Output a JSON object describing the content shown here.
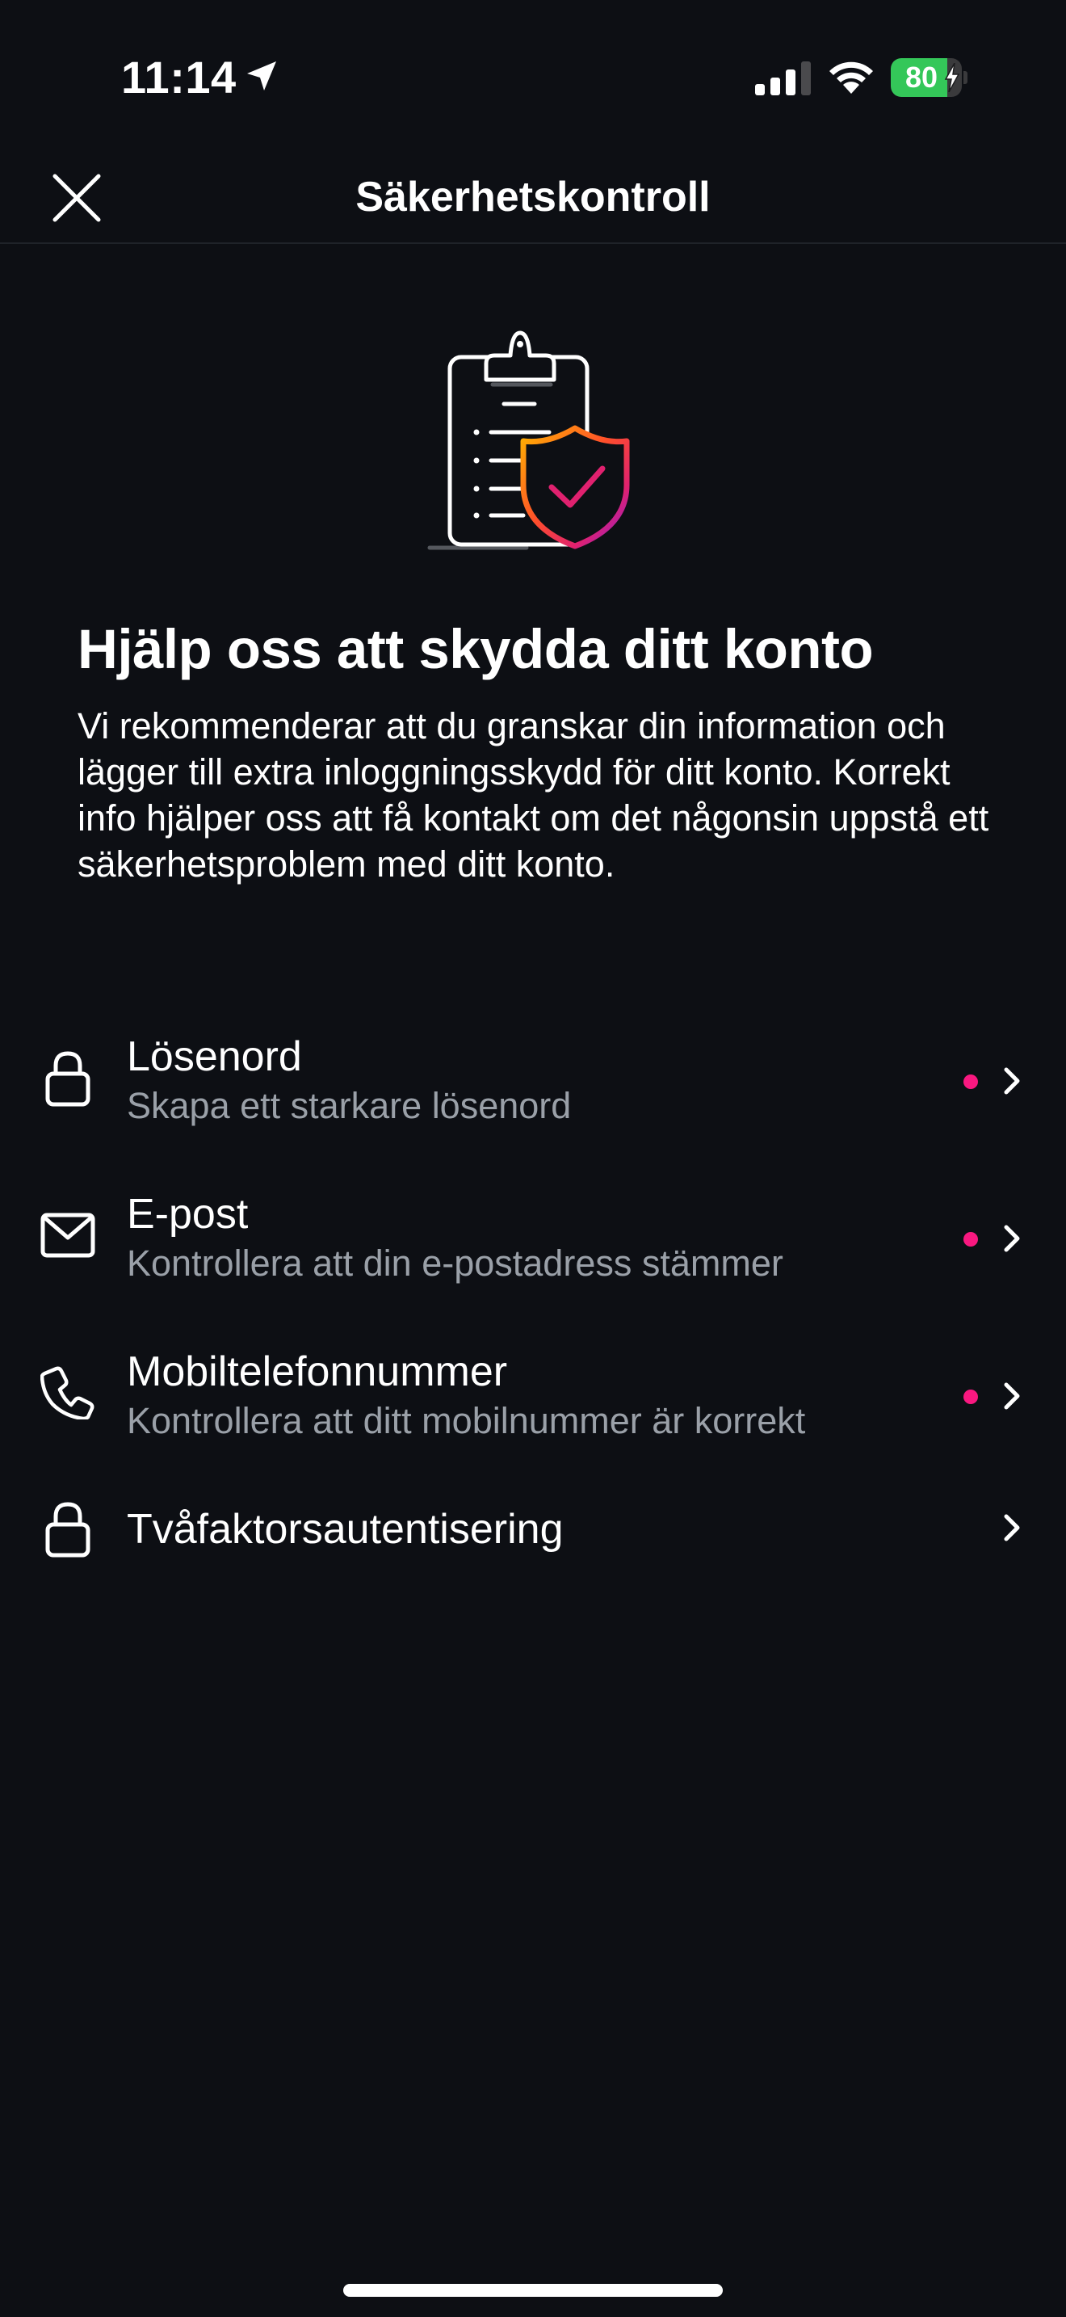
{
  "status_bar": {
    "time": "11:14",
    "battery_level": "80",
    "battery_percent": 0.8,
    "icons": [
      "location-arrow-icon",
      "signal-icon",
      "wifi-icon",
      "battery-charging-icon"
    ]
  },
  "header": {
    "title": "Säkerhetskontroll",
    "close_icon": "close-icon"
  },
  "main": {
    "illustration_icon": "clipboard-shield-check-icon",
    "headline": "Hjälp oss att skydda ditt konto",
    "intro": "Vi rekommenderar att du granskar din information och lägger till extra inloggningsskydd för ditt konto. Korrekt info hjälper oss att få kontakt om det någonsin uppstå ett säkerhetsproblem med ditt konto."
  },
  "options": [
    {
      "icon": "lock-icon",
      "title": "Lösenord",
      "subtitle": "Skapa ett starkare lösenord",
      "has_alert_dot": true
    },
    {
      "icon": "mail-icon",
      "title": "E-post",
      "subtitle": "Kontrollera att din e-postadress stämmer",
      "has_alert_dot": true
    },
    {
      "icon": "phone-icon",
      "title": "Mobiltelefonnummer",
      "subtitle": "Kontrollera att ditt mobilnummer är korrekt",
      "has_alert_dot": true
    },
    {
      "icon": "lock-icon",
      "title": "Tvåfaktorsautentisering",
      "subtitle": "",
      "has_alert_dot": false
    }
  ],
  "colors": {
    "background": "#0d0f14",
    "text_primary": "#ffffff",
    "text_secondary": "#9aa0a8",
    "alert_dot": "#f91880",
    "battery_green": "#34c759",
    "divider": "#1f2329"
  }
}
